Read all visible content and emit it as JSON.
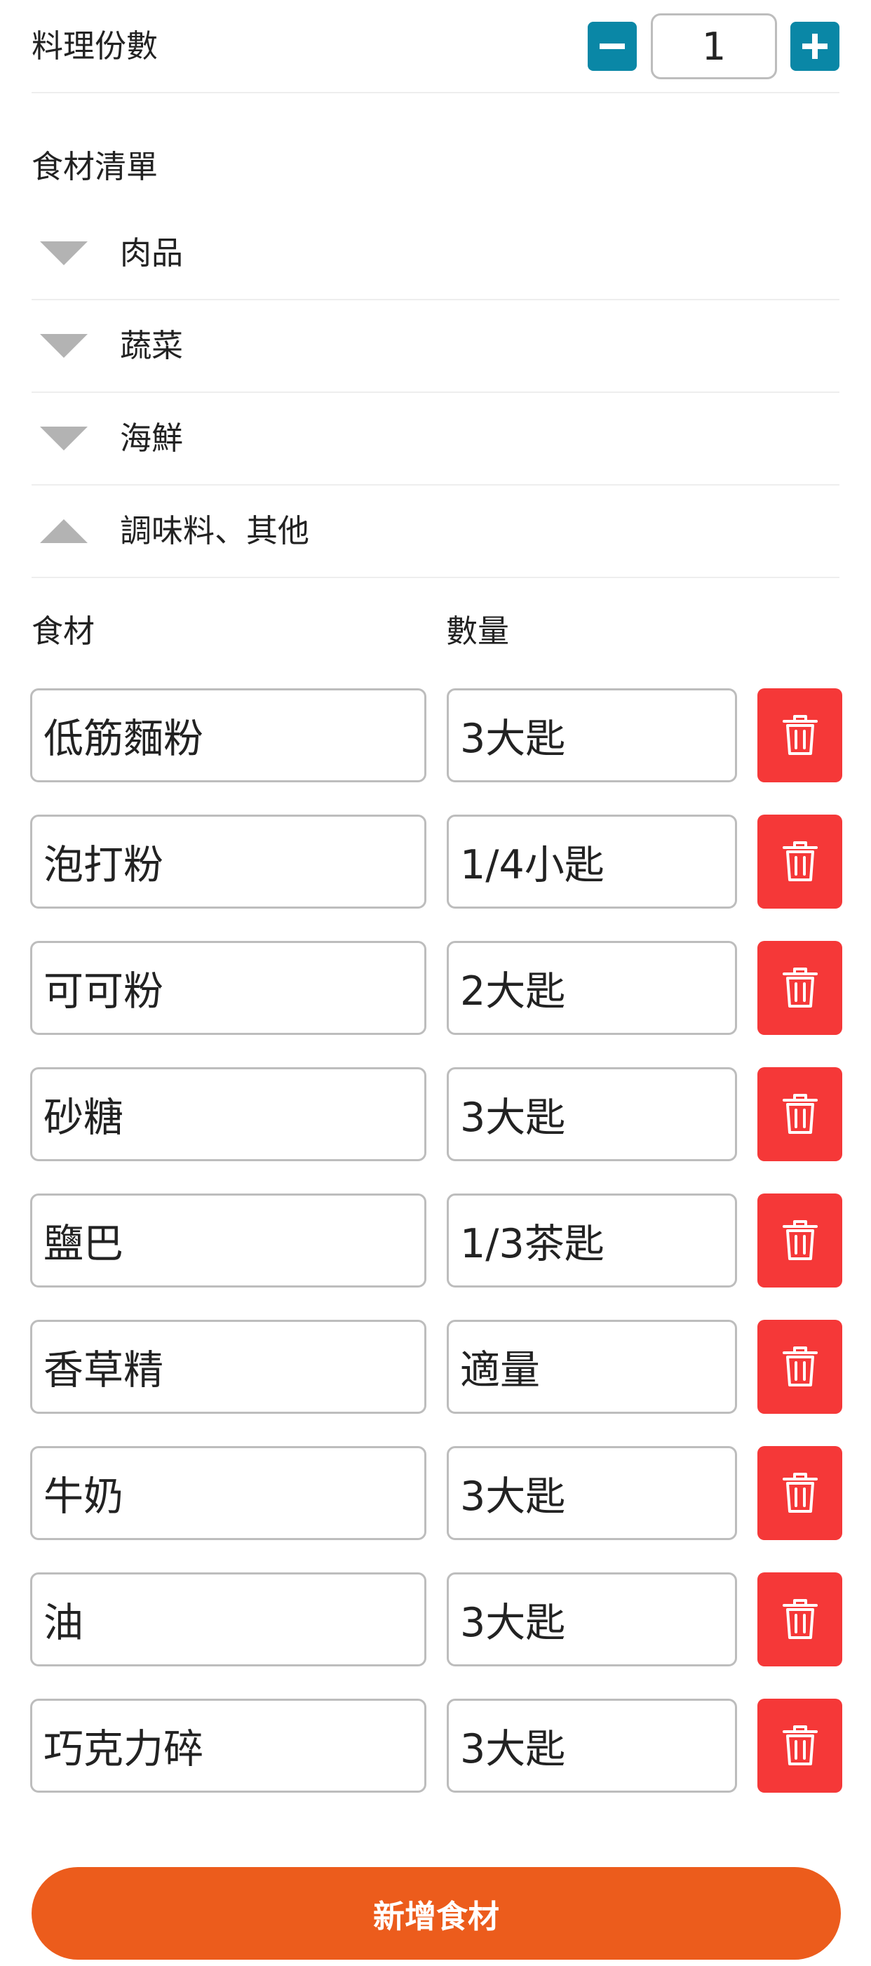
{
  "servings": {
    "label": "料理份數",
    "value": "1",
    "minus_icon": "minus-icon",
    "plus_icon": "plus-icon",
    "accent_color": "#0a87a6"
  },
  "ingredient_list": {
    "title": "食材清單",
    "categories": [
      {
        "label": "肉品",
        "expanded": false
      },
      {
        "label": "蔬菜",
        "expanded": false
      },
      {
        "label": "海鮮",
        "expanded": false
      },
      {
        "label": "調味料、其他",
        "expanded": true
      }
    ]
  },
  "table": {
    "headers": {
      "ingredient": "食材",
      "quantity": "數量"
    },
    "rows": [
      {
        "name": "低筋麵粉",
        "quantity": "3大匙"
      },
      {
        "name": "泡打粉",
        "quantity": "1/4小匙"
      },
      {
        "name": "可可粉",
        "quantity": "2大匙"
      },
      {
        "name": "砂糖",
        "quantity": "3大匙"
      },
      {
        "name": "鹽巴",
        "quantity": "1/3茶匙"
      },
      {
        "name": "香草精",
        "quantity": "適量"
      },
      {
        "name": "牛奶",
        "quantity": "3大匙"
      },
      {
        "name": "油",
        "quantity": "3大匙"
      },
      {
        "name": "巧克力碎",
        "quantity": "3大匙"
      }
    ],
    "delete_icon": "trash-icon",
    "delete_color": "#f53838"
  },
  "add_button": {
    "label": "新增食材",
    "color": "#ec5c1c"
  }
}
